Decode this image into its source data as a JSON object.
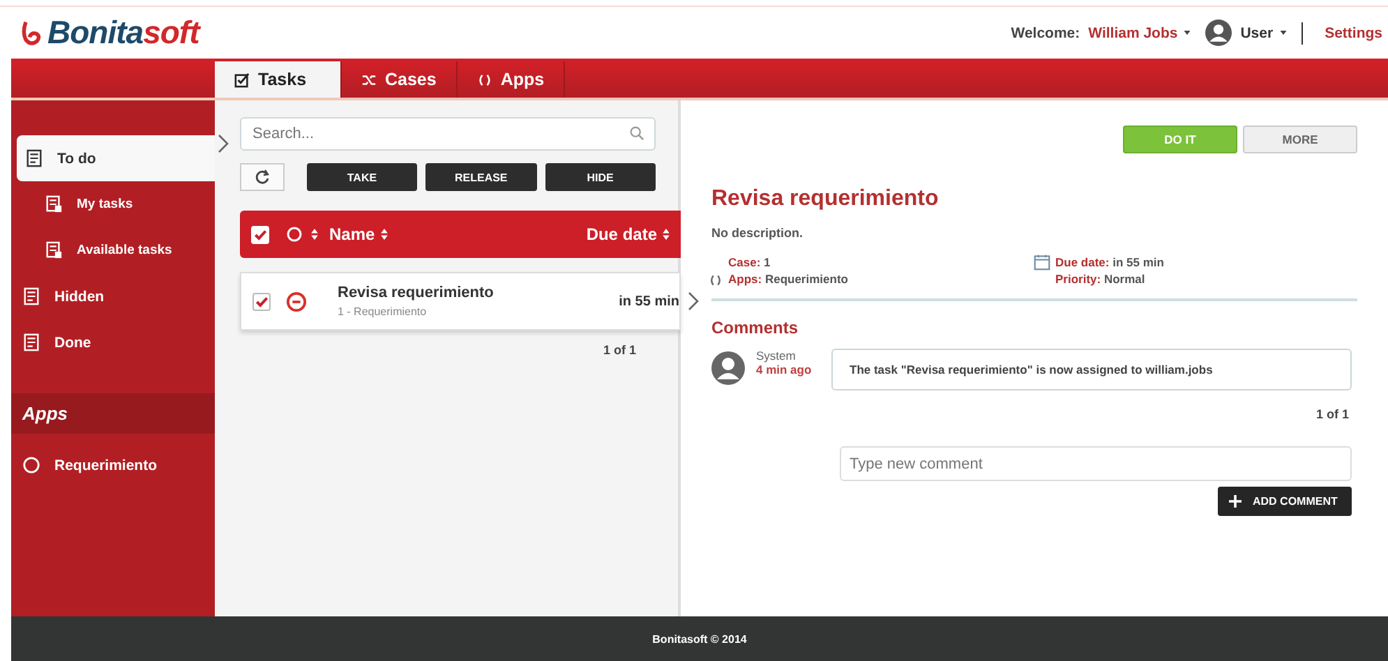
{
  "header": {
    "logo": [
      "Bonita",
      "soft"
    ],
    "welcome_label": "Welcome:",
    "user_name": "William Jobs",
    "profile": "User",
    "settings": "Settings"
  },
  "tabs": [
    {
      "label": "Tasks",
      "selected": true
    },
    {
      "label": "Cases",
      "selected": false
    },
    {
      "label": "Apps",
      "selected": false
    }
  ],
  "sidebar": {
    "items": [
      {
        "label": "To do",
        "selected": true,
        "children": [
          {
            "label": "My tasks",
            "selected": false
          },
          {
            "label": "Available tasks",
            "selected": false
          }
        ]
      },
      {
        "label": "Hidden",
        "selected": false
      },
      {
        "label": "Done",
        "selected": false
      }
    ],
    "apps_title": "Apps",
    "apps": [
      {
        "label": "Requerimiento",
        "selected": false
      }
    ]
  },
  "task_list": {
    "search": {
      "placeholder": "Search..."
    },
    "buttons": [
      "TAKE",
      "RELEASE",
      "HIDE"
    ],
    "select_all_checked": true,
    "columns": [
      "Name",
      "Due date"
    ],
    "rows": [
      {
        "name": "Revisa requerimiento",
        "subtitle": "1 - Requerimiento",
        "due": "in 55 min",
        "checked": true
      }
    ],
    "pager": "1 of 1"
  },
  "detail": {
    "buttons": [
      {
        "label": "DO IT",
        "kind": "primary"
      },
      {
        "label": "MORE",
        "kind": "secondary"
      }
    ],
    "title": "Revisa requerimiento",
    "description": "No description.",
    "fields_left": [
      {
        "label": "Case:",
        "value": "1"
      },
      {
        "label": "Apps:",
        "value": "Requerimiento"
      }
    ],
    "fields_right": [
      {
        "label": "Due date:",
        "value": "in 55 min"
      },
      {
        "label": "Priority:",
        "value": "Normal"
      }
    ],
    "comments_title": "Comments",
    "comments": [
      {
        "author": "System",
        "time": "4 min ago",
        "text": "The task \"Revisa requerimiento\" is now assigned to william.jobs"
      }
    ],
    "comments_pager": "1 of 1",
    "new_comment": {
      "placeholder": "Type new comment"
    },
    "add_comment": "ADD COMMENT"
  },
  "footer": "Bonitasoft © 2014"
}
